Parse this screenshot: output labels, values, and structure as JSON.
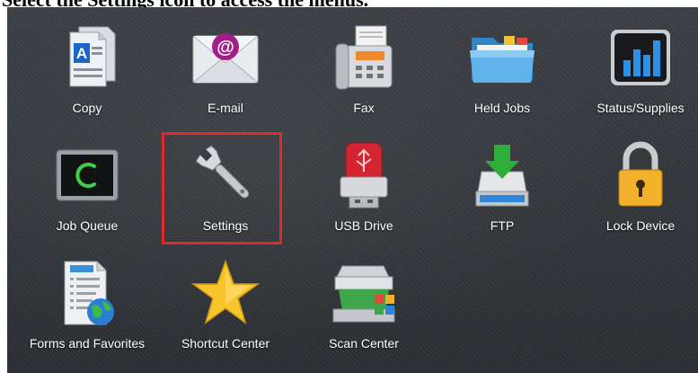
{
  "instruction": "Select the Settings icon to access the menus.",
  "tiles": [
    {
      "label": "Copy",
      "icon": "copy-icon"
    },
    {
      "label": "E-mail",
      "icon": "email-icon"
    },
    {
      "label": "Fax",
      "icon": "fax-icon"
    },
    {
      "label": "Held Jobs",
      "icon": "held-jobs-icon"
    },
    {
      "label": "Status/Supplies",
      "icon": "status-supplies-icon"
    },
    {
      "label": "Job Queue",
      "icon": "job-queue-icon"
    },
    {
      "label": "Settings",
      "icon": "settings-icon"
    },
    {
      "label": "USB Drive",
      "icon": "usb-drive-icon"
    },
    {
      "label": "FTP",
      "icon": "ftp-icon"
    },
    {
      "label": "Lock Device",
      "icon": "lock-icon"
    },
    {
      "label": "Forms and Favorites",
      "icon": "forms-favorites-icon"
    },
    {
      "label": "Shortcut Center",
      "icon": "star-icon"
    },
    {
      "label": "Scan Center",
      "icon": "scanner-icon"
    }
  ],
  "highlight_color": "#e02a2a",
  "highlighted_tile": "Settings"
}
